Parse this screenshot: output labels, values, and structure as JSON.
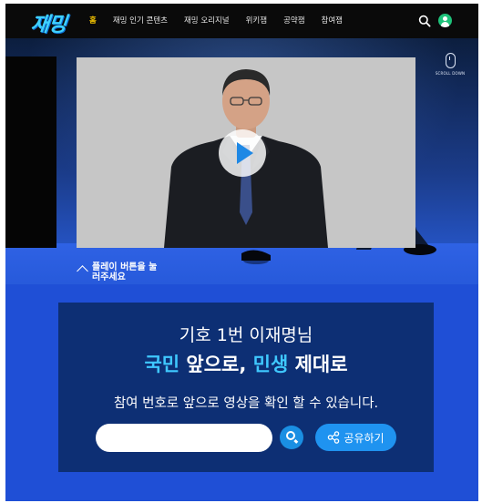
{
  "nav": {
    "logo": "재밍",
    "items": [
      {
        "label": "홈",
        "active": true
      },
      {
        "label": "재밍 인기 콘텐츠",
        "active": false
      },
      {
        "label": "재밍 오리지널",
        "active": false
      },
      {
        "label": "위키잼",
        "active": false
      },
      {
        "label": "공약잼",
        "active": false
      },
      {
        "label": "참여잼",
        "active": false
      }
    ],
    "icons": [
      "search-icon",
      "user-icon"
    ]
  },
  "hero": {
    "scroll_hint": "SCROLL DOWN",
    "play_hint": "플레이 버튼을 눌러주세요",
    "video_icon": "play-icon"
  },
  "panel": {
    "title": "기호 1번 이재명님",
    "slogan_hl1": "국민",
    "slogan_mid": " 앞으로, ",
    "slogan_hl2": "민생",
    "slogan_end": " 제대로",
    "guide": "참여 번호로 앞으로 영상을 확인 할 수 있습니다.",
    "search_value": "",
    "share_label": "공유하기"
  },
  "colors": {
    "accent": "#3fc8ff",
    "nav_active": "#f5c400",
    "panel_bg": "#0d2f74",
    "page_bg": "#1f4fd6",
    "share_bg": "#1f93f0"
  }
}
